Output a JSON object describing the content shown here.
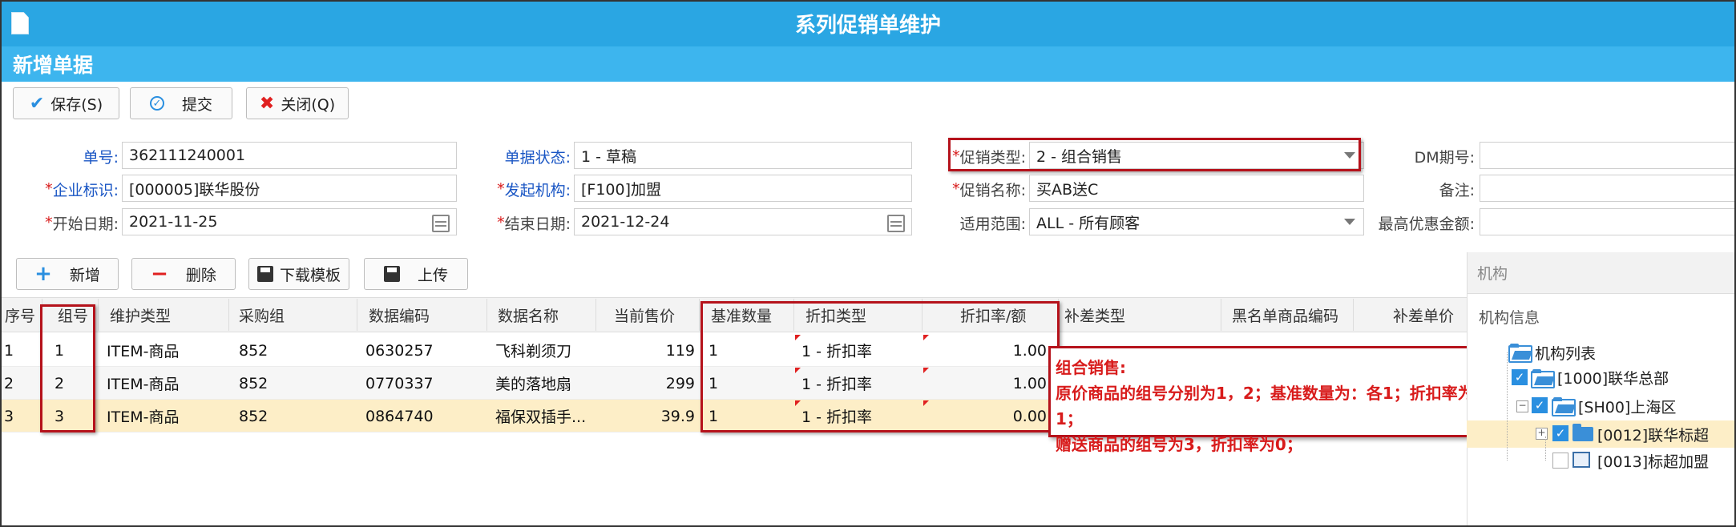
{
  "window": {
    "title": "系列促销单维护",
    "section": "新增单据"
  },
  "toolbar": {
    "save": "保存(S)",
    "submit": "提交",
    "close": "关闭(Q)"
  },
  "form": {
    "bill_no": {
      "label": "单号:",
      "value": "362111240001"
    },
    "company": {
      "label": "企业标识:",
      "value": "[000005]联华股份"
    },
    "start_date": {
      "label": "开始日期:",
      "value": "2021-11-25"
    },
    "status": {
      "label": "单据状态:",
      "value": "1 - 草稿"
    },
    "origin_org": {
      "label": "发起机构:",
      "value": "[F100]加盟"
    },
    "end_date": {
      "label": "结束日期:",
      "value": "2021-12-24"
    },
    "promo_type": {
      "label": "促销类型:",
      "value": "2 - 组合销售"
    },
    "promo_name": {
      "label": "促销名称:",
      "value": "买AB送C"
    },
    "scope": {
      "label": "适用范围:",
      "value": "ALL - 所有顾客"
    },
    "dm_period": {
      "label": "DM期号:",
      "value": ""
    },
    "remark": {
      "label": "备注:",
      "value": ""
    },
    "max_discount": {
      "label": "最高优惠金额:",
      "value": ""
    },
    "required_mark": "*"
  },
  "grid_toolbar": {
    "add": "新增",
    "delete": "删除",
    "download": "下载模板",
    "upload": "上传"
  },
  "grid": {
    "columns": [
      "序号",
      "组号",
      "维护类型",
      "采购组",
      "数据编码",
      "数据名称",
      "当前售价",
      "基准数量",
      "折扣类型",
      "折扣率/额",
      "补差类型",
      "黑名单商品编码",
      "补差单价"
    ],
    "rows": [
      {
        "seq": "1",
        "group": "1",
        "type": "ITEM-商品",
        "purchase_group": "852",
        "code": "0630257",
        "name": "飞科剃须刀",
        "price": "119",
        "base_qty": "1",
        "discount_type": "1 - 折扣率",
        "discount": "1.00"
      },
      {
        "seq": "2",
        "group": "2",
        "type": "ITEM-商品",
        "purchase_group": "852",
        "code": "0770337",
        "name": "美的落地扇",
        "price": "299",
        "base_qty": "1",
        "discount_type": "1 - 折扣率",
        "discount": "1.00"
      },
      {
        "seq": "3",
        "group": "3",
        "type": "ITEM-商品",
        "purchase_group": "852",
        "code": "0864740",
        "name": "福保双插手...",
        "price": "39.9",
        "base_qty": "1",
        "discount_type": "1 - 折扣率",
        "discount": "0.00"
      }
    ]
  },
  "annotation": {
    "title": "组合销售:",
    "line1": "原价商品的组号分别为1，2；基准数量为：各1；折扣率为1；",
    "line2": "赠送商品的组号为3，折扣率为0；"
  },
  "org_panel": {
    "header": "机构",
    "info": "机构信息",
    "tree": [
      {
        "label": "机构列表"
      },
      {
        "label": "[1000]联华总部"
      },
      {
        "label": "[SH00]上海区"
      },
      {
        "label": "[0012]联华标超"
      },
      {
        "label": "[0013]标超加盟"
      }
    ]
  },
  "colors": {
    "title_bar": "#2aa6e3",
    "sub_bar": "#3db5ee",
    "highlight_row": "#fdeec7",
    "annotation_red": "#d81b1b",
    "box_red": "#b5121b"
  }
}
